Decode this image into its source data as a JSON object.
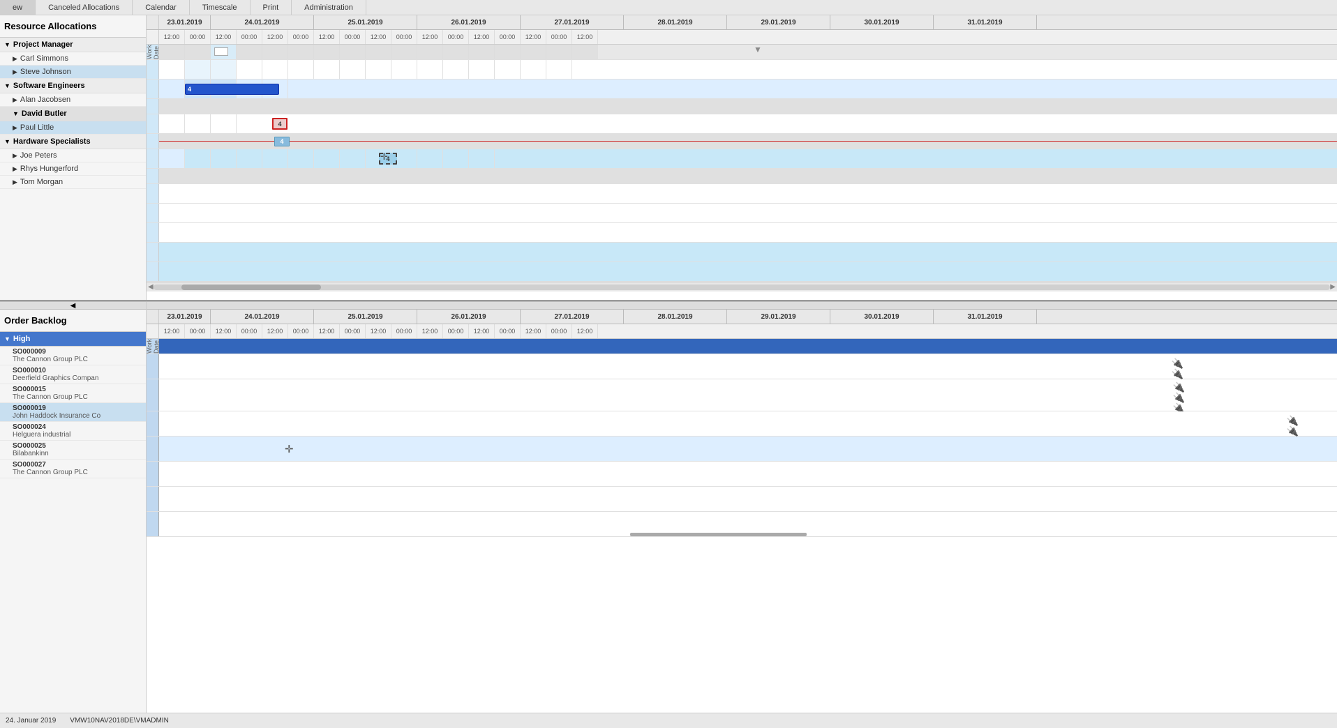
{
  "menu": {
    "items": [
      "ew",
      "Canceled Allocations",
      "Calendar",
      "Timescale",
      "Print",
      "Administration"
    ]
  },
  "resource_allocations": {
    "title": "Resource Allocations",
    "groups": [
      {
        "name": "Project Manager",
        "members": [
          "Carl Simmons",
          "Steve Johnson"
        ]
      },
      {
        "name": "Software Engineers",
        "members": [
          "Alan Jacobsen",
          "David Butler",
          "Paul Little"
        ]
      },
      {
        "name": "Hardware Specialists",
        "members": [
          "Joe Peters",
          "Rhys Hungerford",
          "Tom Morgan"
        ]
      }
    ]
  },
  "order_backlog": {
    "title": "Order Backlog",
    "groups": [
      {
        "name": "High",
        "items": [
          {
            "num": "SO000009",
            "name": "The Cannon Group PLC"
          },
          {
            "num": "SO000010",
            "name": "Deerfield Graphics Compan"
          },
          {
            "num": "SO000015",
            "name": "The Cannon Group PLC"
          },
          {
            "num": "SO000019",
            "name": "John Haddock Insurance Co"
          },
          {
            "num": "SO000024",
            "name": "Helguera industrial"
          },
          {
            "num": "SO000025",
            "name": "Bilabankinn"
          },
          {
            "num": "SO000027",
            "name": "The Cannon Group PLC"
          }
        ]
      }
    ]
  },
  "dates": [
    "23.01.2019",
    "24.01.2019",
    "25.01.2019",
    "26.01.2019",
    "27.01.2019",
    "28.01.2019",
    "29.01.2019",
    "30.01.2019",
    "31.01.2019"
  ],
  "times": [
    "12:00",
    "00:00",
    "12:00",
    "00:00",
    "12:00",
    "00:00",
    "12:00",
    "00:00",
    "12:00",
    "00:00",
    "12:00",
    "00:00",
    "12:00",
    "00:00",
    "12:00",
    "00:00",
    "12:00"
  ],
  "status_bar": {
    "date": "24. Januar 2019",
    "user": "VMW10NAV2018DE\\VMADMIN"
  }
}
